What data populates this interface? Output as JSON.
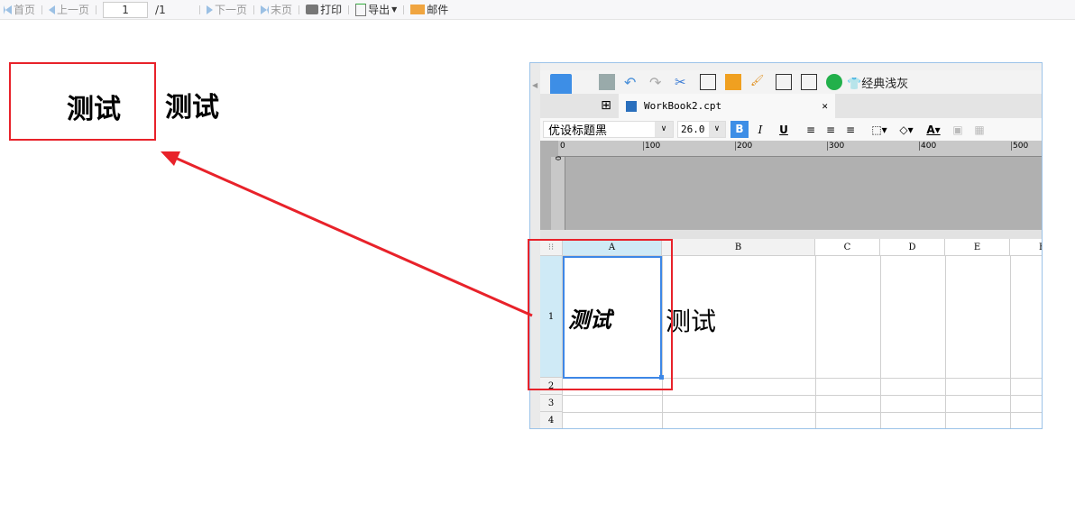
{
  "toolbar": {
    "first": "首页",
    "prev": "上一页",
    "page": "1",
    "total": "/1",
    "next": "下一页",
    "last": "末页",
    "print": "打印",
    "export": "导出",
    "mail": "邮件"
  },
  "preview": {
    "cell_a1": "测试",
    "cell_b1": "测试"
  },
  "designer": {
    "theme_label": "经典浅灰",
    "tab_name": "WorkBook2.cpt",
    "font_name": "优设标题黑",
    "font_size": "26.0",
    "bold": "B",
    "italic": "I",
    "underline": "U",
    "ruler_ticks": [
      "0",
      "100",
      "200",
      "300",
      "400",
      "500"
    ],
    "vruler": "0",
    "columns": [
      "A",
      "B",
      "C",
      "D",
      "E",
      "F"
    ],
    "rows": [
      "1",
      "2",
      "3",
      "4"
    ],
    "cell_a1": "测试",
    "cell_b1": "测试"
  },
  "colors": {
    "annotation": "#e8222a",
    "selection": "#3d87e6"
  }
}
